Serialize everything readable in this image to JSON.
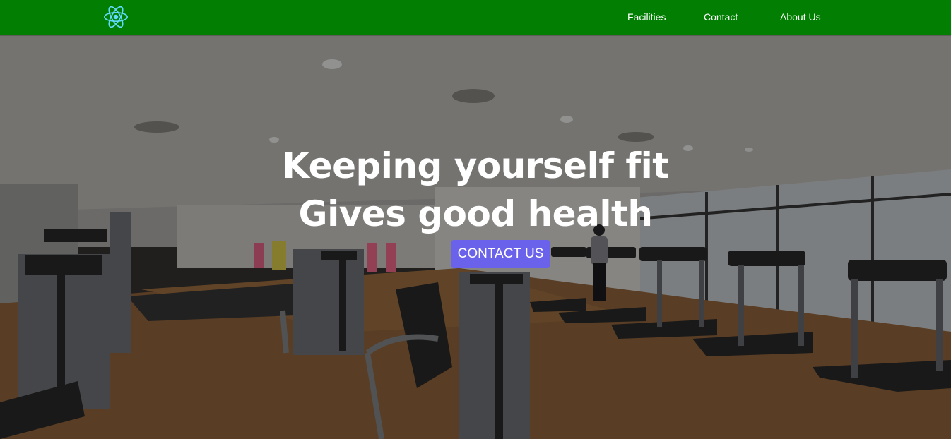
{
  "nav": {
    "logo_icon": "react-atom-icon",
    "links": [
      "Facilities",
      "Contact",
      "About Us"
    ],
    "background": "#027f02"
  },
  "hero": {
    "headline_line1": "Keeping yourself fit",
    "headline_line2": "Gives good health",
    "cta_label": "CONTACT US",
    "cta_color": "#6a62ea",
    "background_image": "gym-interior-photo"
  }
}
